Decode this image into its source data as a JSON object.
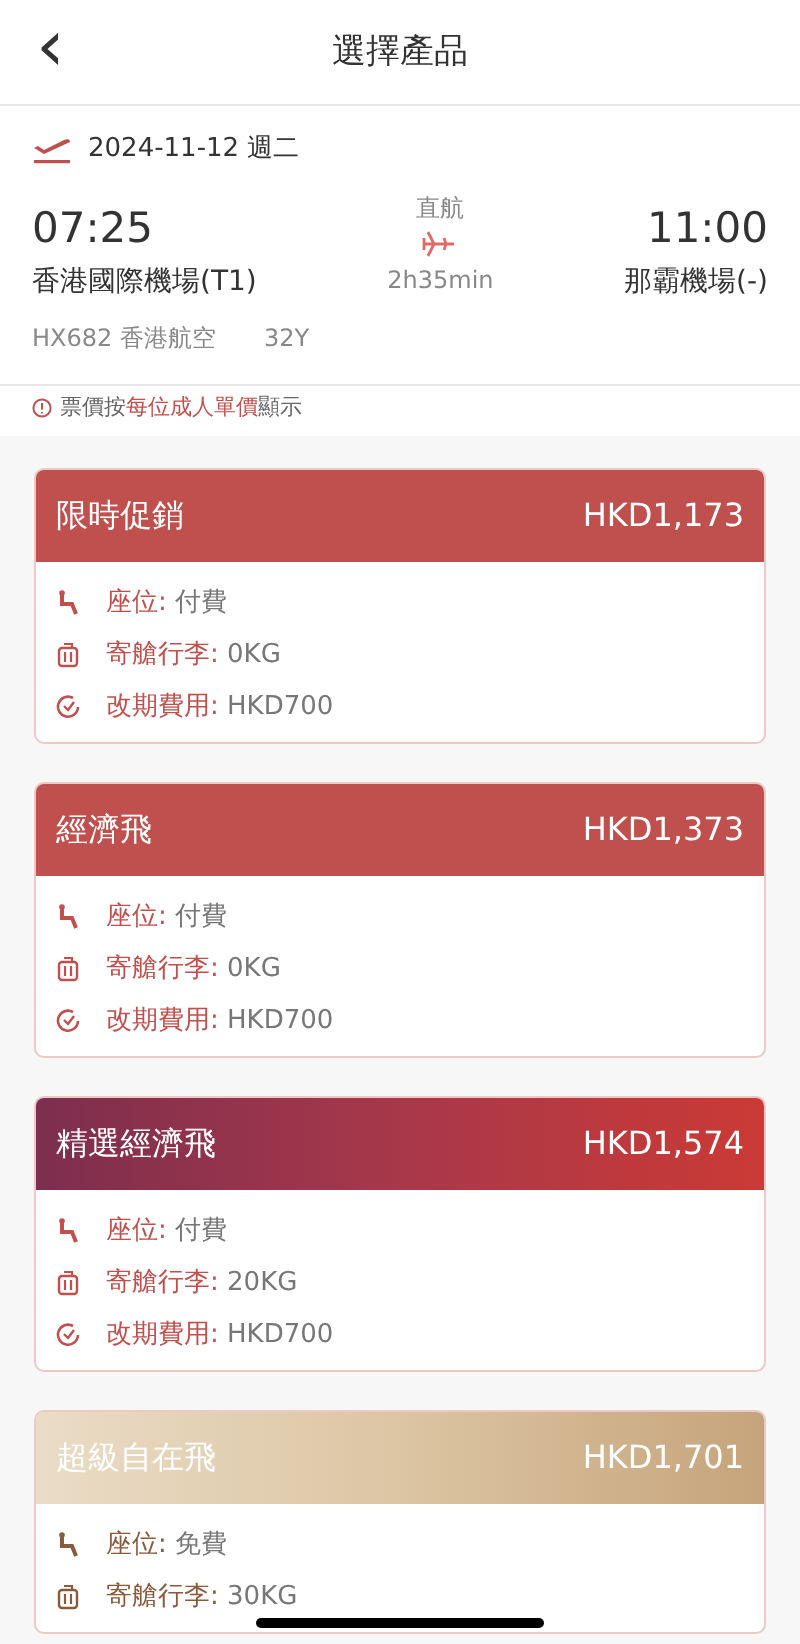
{
  "header": {
    "back": "‹",
    "title": "選擇產品"
  },
  "flight": {
    "date": "2024-11-12 週二",
    "depart_time": "07:25",
    "depart_airport": "香港國際機場(T1)",
    "stop": "直航",
    "duration": "2h35min",
    "arrive_time": "11:00",
    "arrive_airport": "那霸機場(-)",
    "flight_no": "HX682 香港航空",
    "cabin": "32Y"
  },
  "notice": "票價按**每位成人單價**顯示",
  "products": [
    {
      "name": "限時促銷",
      "price": "HKD1,173",
      "kind": "promo",
      "features": [
        {
          "kind": "seat",
          "label": "座位:",
          "value": "付費"
        },
        {
          "kind": "bag",
          "label": "寄艙行李:",
          "value": "0KG"
        },
        {
          "kind": "change",
          "label": "改期費用:",
          "value": "HKD700"
        }
      ]
    },
    {
      "name": "經濟飛",
      "price": "HKD1,373",
      "kind": "promo",
      "features": [
        {
          "kind": "seat",
          "label": "座位:",
          "value": "付費"
        },
        {
          "kind": "bag",
          "label": "寄艙行李:",
          "value": "0KG"
        },
        {
          "kind": "change",
          "label": "改期費用:",
          "value": "HKD700"
        }
      ]
    },
    {
      "name": "精選經濟飛",
      "price": "HKD1,574",
      "kind": "select",
      "features": [
        {
          "kind": "seat",
          "label": "座位:",
          "value": "付費"
        },
        {
          "kind": "bag",
          "label": "寄艙行李:",
          "value": "20KG"
        },
        {
          "kind": "change",
          "label": "改期費用:",
          "value": "HKD700"
        }
      ]
    },
    {
      "name": "超級自在飛",
      "price": "HKD1,701",
      "kind": "super",
      "features": [
        {
          "kind": "seat",
          "label": "座位:",
          "value": "免費"
        },
        {
          "kind": "bag",
          "label": "寄艙行李:",
          "value": "30KG"
        }
      ]
    }
  ]
}
